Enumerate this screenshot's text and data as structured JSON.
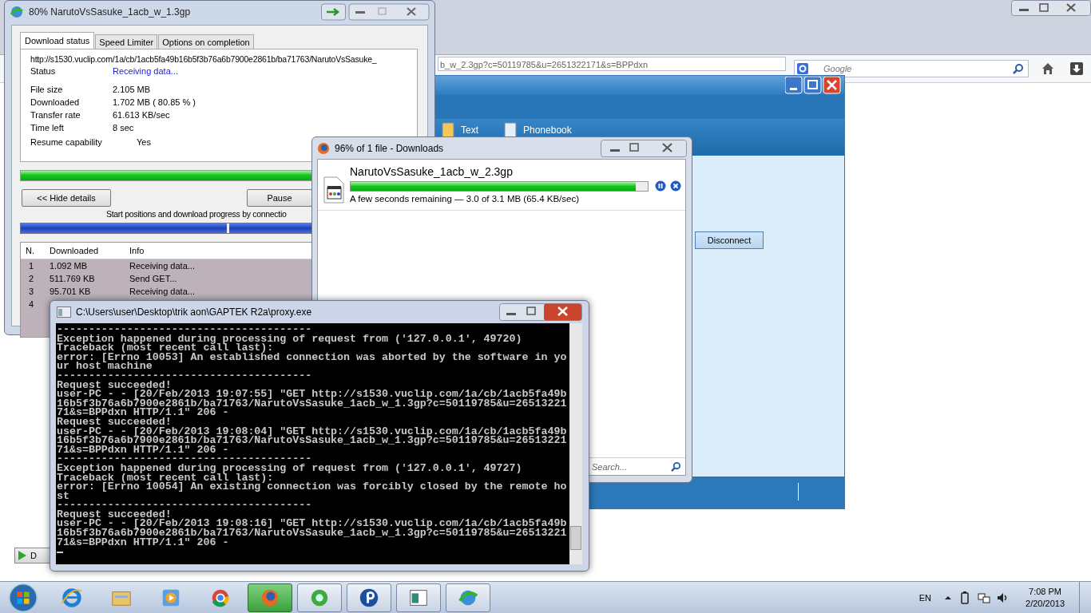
{
  "browser": {
    "url": "b_w_2.3gp?c=50119785&u=2651322171&s=BPPdxn",
    "search_placeholder": "Google"
  },
  "app_window": {
    "toolbar": [
      {
        "label": "Text"
      },
      {
        "label": "Phonebook"
      }
    ],
    "button": "Disconnect"
  },
  "idm": {
    "title": "80% NarutoVsSasuke_1acb_w_1.3gp",
    "tabs": [
      {
        "label": "Download status",
        "selected": true
      },
      {
        "label": "Speed Limiter",
        "selected": false
      },
      {
        "label": "Options on completion",
        "selected": false
      }
    ],
    "url": "http://s1530.vuclip.com/1a/cb/1acb5fa49b16b5f3b76a6b7900e2861b/ba71763/NarutoVsSasuke_",
    "status": {
      "label": "Status",
      "value": "Receiving data..."
    },
    "fields": [
      {
        "label": "File size",
        "value": "2.105  MB"
      },
      {
        "label": "Downloaded",
        "value": "1.702  MB  ( 80.85 % )"
      },
      {
        "label": "Transfer rate",
        "value": "61.613  KB/sec"
      },
      {
        "label": "Time left",
        "value": "8 sec"
      }
    ],
    "resume": {
      "label": "Resume capability",
      "value": "Yes"
    },
    "level": 0.8085,
    "buttons": [
      "<< Hide details",
      "Pause"
    ],
    "caption": "Start positions and download progress by connectio",
    "connection_bar": {
      "level": 0.52
    },
    "columns": [
      "N.",
      "Downloaded",
      "Info"
    ],
    "rows": [
      {
        "n": "1",
        "downloaded": "1.092  MB",
        "info": "Receiving data..."
      },
      {
        "n": "2",
        "downloaded": "511.769  KB",
        "info": "Send GET..."
      },
      {
        "n": "3",
        "downloaded": "95.701  KB",
        "info": "Receiving data..."
      },
      {
        "n": "4"
      }
    ]
  },
  "idm_mini": {
    "label": "D"
  },
  "downloads": {
    "title": "96% of 1 file - Downloads",
    "file": "NarutoVsSasuke_1acb_w_2.3gp",
    "level": 0.96,
    "status": "A few seconds remaining — 3.0 of 3.1 MB (65.4 KB/sec)",
    "search_placeholder": "Search..."
  },
  "console": {
    "title": "C:\\Users\\user\\Desktop\\trik aon\\GAPTEK R2a\\proxy.exe",
    "lines": [
      "----------------------------------------",
      "Exception happened during processing of request from ('127.0.0.1', 49720)",
      "Traceback (most recent call last):",
      "error: [Errno 10053] An established connection was aborted by the software in yo",
      "ur host machine",
      "----------------------------------------",
      "Request succeeded!",
      "user-PC - - [20/Feb/2013 19:07:55] \"GET http://s1530.vuclip.com/1a/cb/1acb5fa49b",
      "16b5f3b76a6b7900e2861b/ba71763/NarutoVsSasuke_1acb_w_1.3gp?c=50119785&u=26513221",
      "71&s=BPPdxn HTTP/1.1\" 206 -",
      "Request succeeded!",
      "user-PC - - [20/Feb/2013 19:08:04] \"GET http://s1530.vuclip.com/1a/cb/1acb5fa49b",
      "16b5f3b76a6b7900e2861b/ba71763/NarutoVsSasuke_1acb_w_1.3gp?c=50119785&u=26513221",
      "71&s=BPPdxn HTTP/1.1\" 206 -",
      "----------------------------------------",
      "Exception happened during processing of request from ('127.0.0.1', 49727)",
      "Traceback (most recent call last):",
      "error: [Errno 10054] An existing connection was forcibly closed by the remote ho",
      "st",
      "----------------------------------------",
      "Request succeeded!",
      "user-PC - - [20/Feb/2013 19:08:16] \"GET http://s1530.vuclip.com/1a/cb/1acb5fa49b",
      "16b5f3b76a6b7900e2861b/ba71763/NarutoVsSasuke_1acb_w_1.3gp?c=50119785&u=26513221",
      "71&s=BPPdxn HTTP/1.1\" 206 -"
    ]
  },
  "taskbar": {
    "apps": [
      {
        "kind": "ie",
        "selected": false
      },
      {
        "kind": "folder",
        "selected": false
      },
      {
        "kind": "media",
        "selected": false
      },
      {
        "kind": "chrome",
        "selected": false
      },
      {
        "kind": "firefox",
        "selected": true
      },
      {
        "kind": "green",
        "selected": false
      },
      {
        "kind": "p",
        "selected": false
      },
      {
        "kind": "window",
        "selected": false
      },
      {
        "kind": "globe",
        "selected": false
      }
    ],
    "language": "EN",
    "time": "7:08 PM",
    "date": "2/20/2013"
  }
}
